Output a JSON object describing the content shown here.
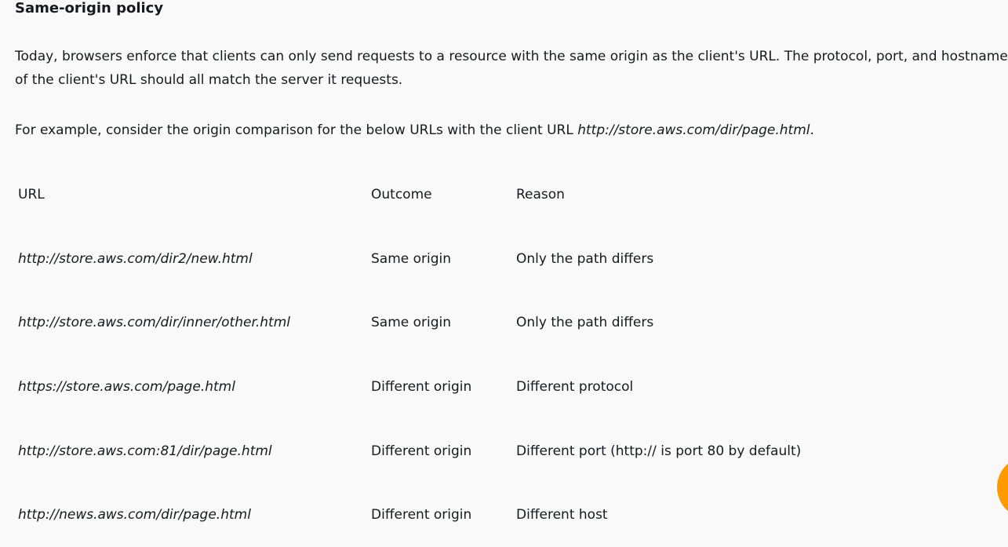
{
  "section": {
    "title": "Same-origin policy",
    "paragraph1": "Today, browsers enforce that clients can only send requests to a resource with the same origin as the client's URL. The protocol, port, and hostname of the client's URL should all match the server it requests.",
    "paragraph2_prefix": "For example, consider the origin comparison for the below URLs with the client URL ",
    "paragraph2_url": "http://store.aws.com/dir/page.html",
    "paragraph2_suffix": "."
  },
  "table": {
    "headers": {
      "url": "URL",
      "outcome": "Outcome",
      "reason": "Reason"
    },
    "rows": [
      {
        "url": "http://store.aws.com/dir2/new.html",
        "outcome": "Same origin",
        "reason": "Only the path differs"
      },
      {
        "url": "http://store.aws.com/dir/inner/other.html",
        "outcome": "Same origin",
        "reason": "Only the path differs"
      },
      {
        "url": "https://store.aws.com/page.html",
        "outcome": "Different origin",
        "reason": "Different protocol"
      },
      {
        "url": "http://store.aws.com:81/dir/page.html",
        "outcome": "Different origin",
        "reason": "Different port (http:// is port 80 by default)"
      },
      {
        "url": "http://news.aws.com/dir/page.html",
        "outcome": "Different origin",
        "reason": "Different host"
      }
    ]
  },
  "colors": {
    "accent": "#ff9900",
    "background": "#f9f9f9",
    "text": "#16191f"
  },
  "icons": {
    "chat_fab": "chat-icon"
  }
}
